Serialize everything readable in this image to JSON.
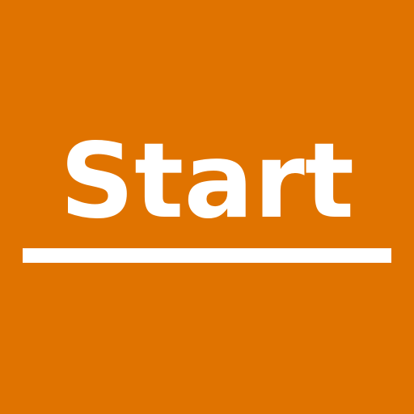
{
  "start_button": {
    "label": "Start"
  },
  "colors": {
    "background": "#E07300",
    "foreground": "#FFFFFF"
  }
}
